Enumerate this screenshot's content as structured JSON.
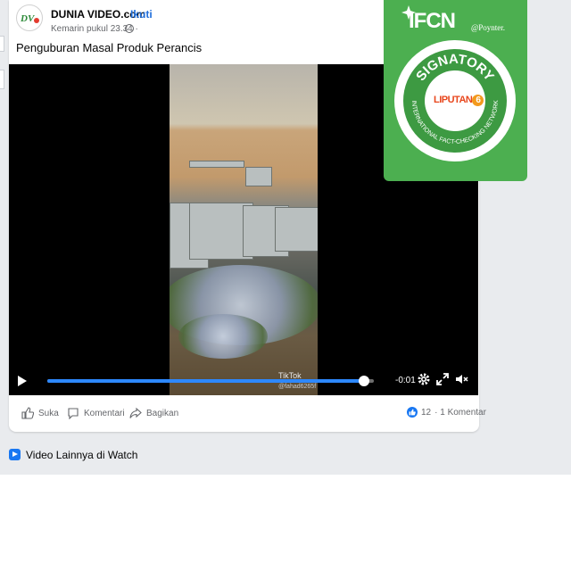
{
  "post": {
    "page_name": "DUNIA VIDEO.com",
    "separator": "·",
    "follow_label": "Ikuti",
    "timestamp": "Kemarin pukul 23.34 ·",
    "caption": "Penguburan Masal Produk Perancis",
    "avatar_text": "DV"
  },
  "video": {
    "time_remaining": "-0:01",
    "progress": 0.97,
    "watermark": "TikTok",
    "watermark_user": "@fahad6265f"
  },
  "actions": {
    "like_label": "Suka",
    "comment_label": "Komentari",
    "share_label": "Bagikan",
    "reactions_count": "12",
    "comments_count": "· 1 Komentar"
  },
  "watch": {
    "label": "Video Lainnya di Watch"
  },
  "badge": {
    "title": "IFCN",
    "poynter": "@Poynter.",
    "ring_text_top": "SIGNATORY",
    "ring_text_bottom": "INTERNATIONAL FACT-CHECKING NETWORK",
    "logo": "LIPUTAN",
    "logo_number": "6",
    "brand_color": "#4caf50"
  },
  "colors": {
    "link": "#216fdb",
    "progress": "#2d88ff",
    "background": "#e9ebee"
  }
}
